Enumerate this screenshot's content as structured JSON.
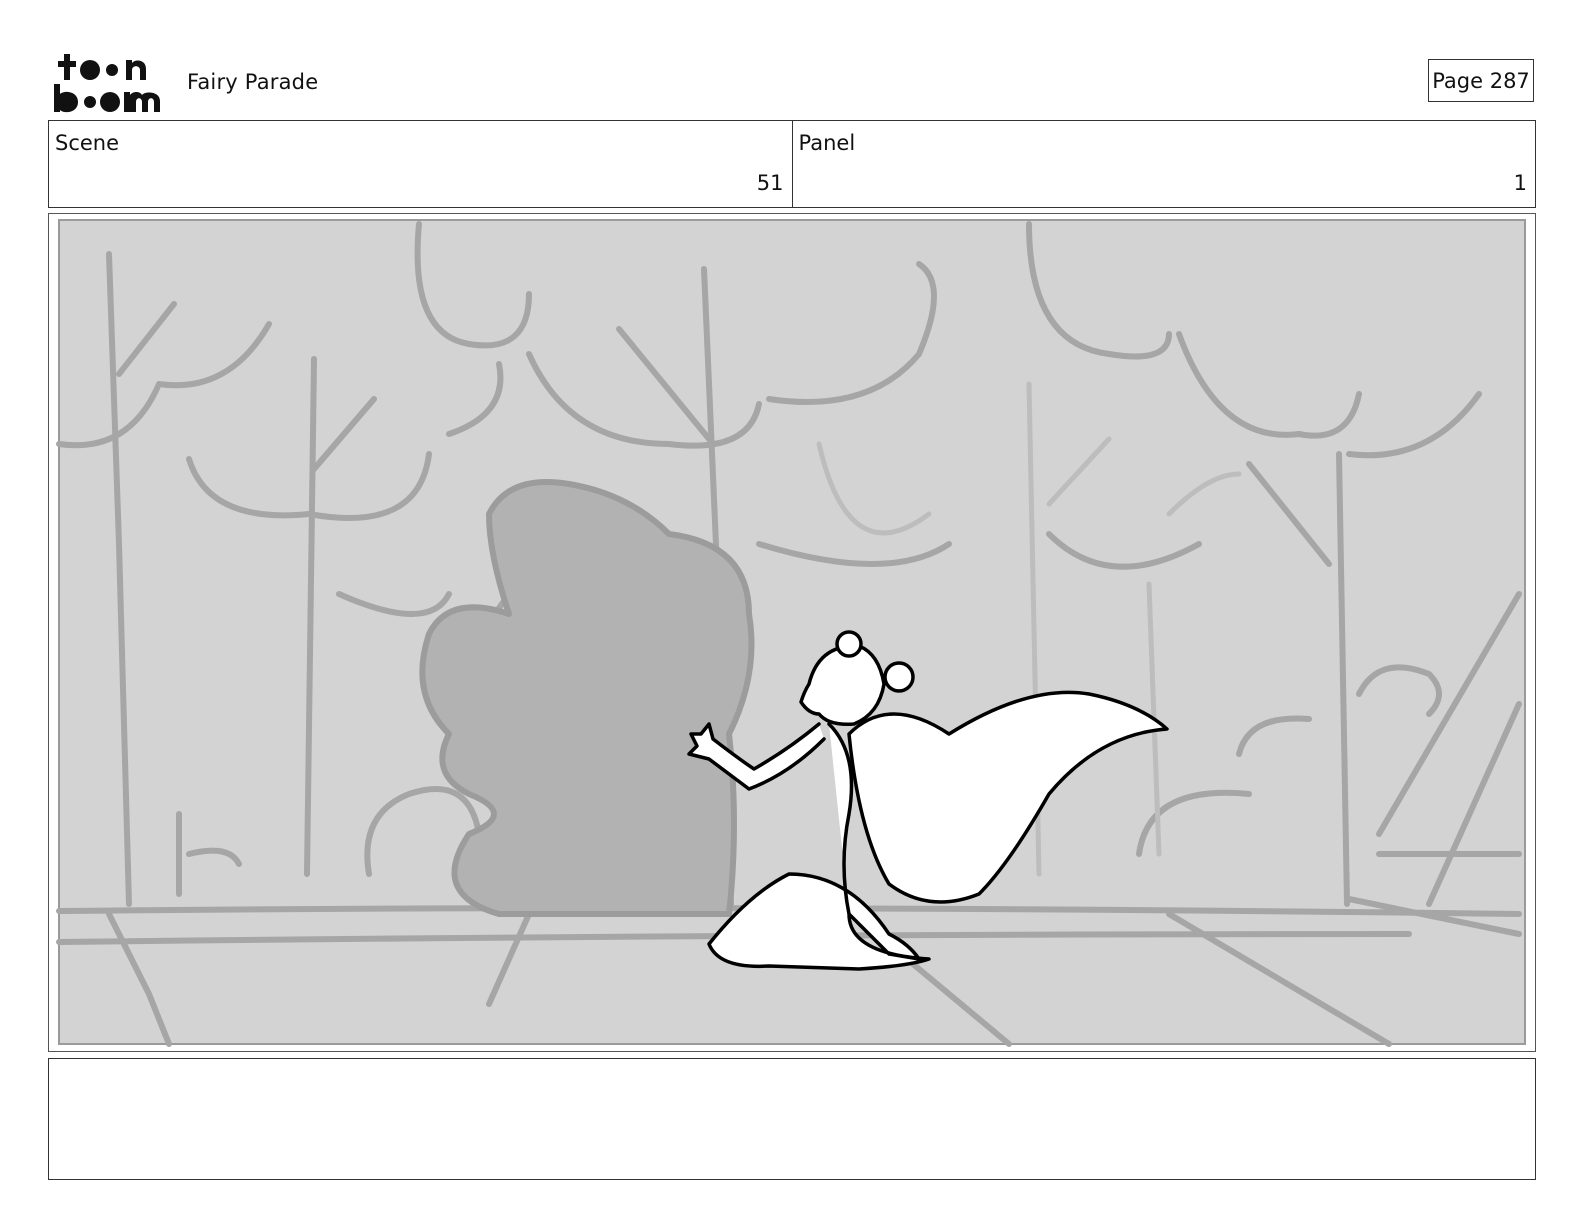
{
  "header": {
    "logo_text": "toon boom",
    "project_title": "Fairy Parade",
    "page_label": "Page 287"
  },
  "scene": {
    "label": "Scene",
    "value": "51"
  },
  "panel": {
    "label": "Panel",
    "value": "1"
  },
  "artwork": {
    "description_name": "storyboard-sketch",
    "background_color": "#d3d3d3",
    "line_color": "#a6a6a6",
    "shadow_color": "#aaaaaa",
    "figure_fill": "#ffffff",
    "figure_line": "#000000"
  },
  "notes": {
    "text": ""
  }
}
